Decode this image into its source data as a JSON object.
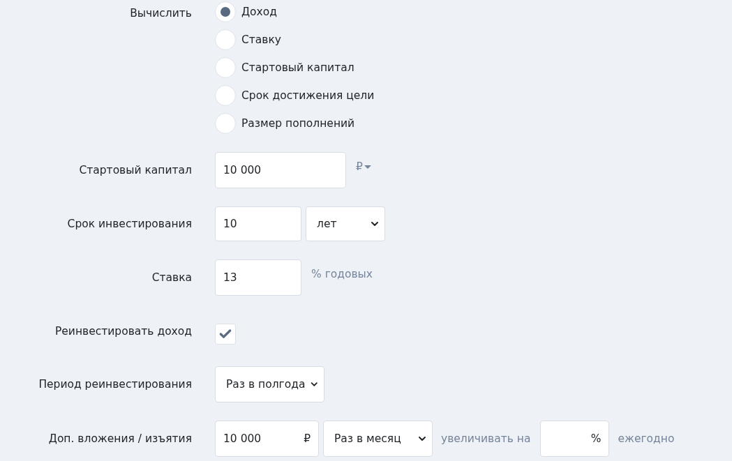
{
  "rows": [
    {
      "kind": "radio",
      "label": "Вычислить",
      "options": [
        {
          "label": "Доход",
          "selected": true
        },
        {
          "label": "Ставку",
          "selected": false
        },
        {
          "label": "Стартовый капитал",
          "selected": false
        },
        {
          "label": "Срок достижения цели",
          "selected": false
        },
        {
          "label": "Размер пополнений",
          "selected": false
        }
      ]
    },
    {
      "kind": "amount",
      "label": "Стартовый капитал",
      "value": "10 000",
      "currency": "₽"
    },
    {
      "kind": "term",
      "label": "Срок инвестирования",
      "value": "10",
      "unit": "лет"
    },
    {
      "kind": "rate",
      "label": "Ставка",
      "value": "13",
      "suffix": "% годовых"
    },
    {
      "kind": "checkbox",
      "label": "Реинвестировать доход",
      "checked": true
    },
    {
      "kind": "select",
      "label": "Период реинвестирования",
      "value": "Раз в полгода"
    },
    {
      "kind": "contribution",
      "label": "Доп. вложения / изъятия",
      "value": "10 000",
      "currency": "₽",
      "period": "Раз в месяц",
      "increase_label": "увеличивать на",
      "percent_sign": "%",
      "after": "ежегодно"
    }
  ]
}
